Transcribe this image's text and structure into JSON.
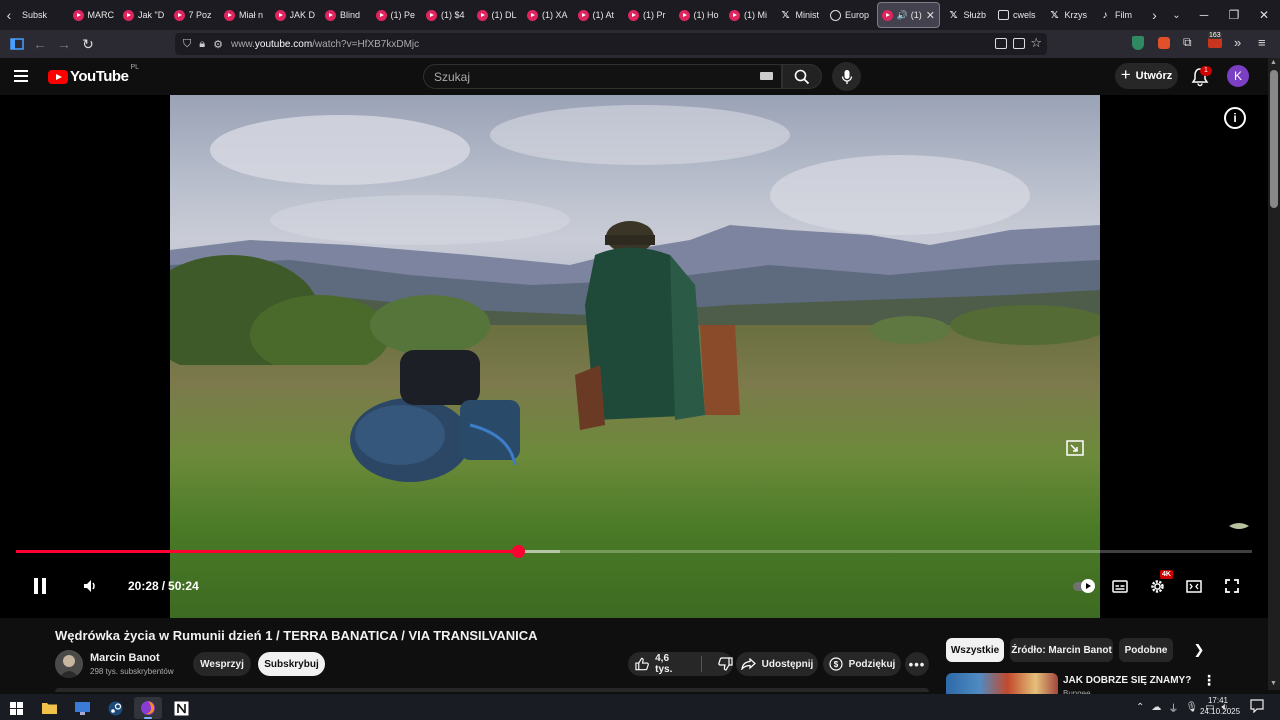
{
  "browser": {
    "tabs": [
      {
        "label": "Subsk",
        "icon": "youtube-icon",
        "kind": "none"
      },
      {
        "label": "MARC",
        "icon": "youtube-icon",
        "kind": "yt"
      },
      {
        "label": "Jak \"D",
        "icon": "youtube-icon",
        "kind": "yt"
      },
      {
        "label": "7 Poz",
        "icon": "youtube-icon",
        "kind": "yt"
      },
      {
        "label": "Miał n",
        "icon": "youtube-icon",
        "kind": "yt"
      },
      {
        "label": "JAK D",
        "icon": "youtube-icon",
        "kind": "yt"
      },
      {
        "label": "Blind",
        "icon": "youtube-icon",
        "kind": "yt"
      },
      {
        "label": "(1) Pe",
        "icon": "youtube-icon",
        "kind": "yt"
      },
      {
        "label": "(1) $4",
        "icon": "youtube-icon",
        "kind": "yt"
      },
      {
        "label": "(1) DL",
        "icon": "youtube-icon",
        "kind": "yt"
      },
      {
        "label": "(1) XA",
        "icon": "youtube-icon",
        "kind": "yt"
      },
      {
        "label": "(1) At",
        "icon": "youtube-icon",
        "kind": "yt"
      },
      {
        "label": "(1) Pr",
        "icon": "youtube-icon",
        "kind": "yt"
      },
      {
        "label": "(1) Ho",
        "icon": "youtube-icon",
        "kind": "yt"
      },
      {
        "label": "(1) Mi",
        "icon": "youtube-icon",
        "kind": "yt"
      },
      {
        "label": "Minist",
        "icon": "x-icon",
        "kind": "x"
      },
      {
        "label": "Europ",
        "icon": "globe-icon",
        "kind": "globe"
      }
    ],
    "active_tab": {
      "label": "(1)"
    },
    "tabs_after": [
      {
        "label": "Służb",
        "icon": "x-icon",
        "kind": "x"
      },
      {
        "label": "cwels",
        "icon": "doc-icon",
        "kind": "doc"
      },
      {
        "label": "Krzys",
        "icon": "x-icon",
        "kind": "x"
      },
      {
        "label": "Film",
        "icon": "tiktok-icon",
        "kind": "tt"
      }
    ],
    "url_prefix": "www.",
    "url_host": "youtube.com",
    "url_path": "/watch?v=HfXB7kxDMjc",
    "extension_badge": "163"
  },
  "youtube": {
    "logo_text": "YouTube",
    "logo_country": "PL",
    "search_placeholder": "Szukaj",
    "create_label": "Utwórz",
    "notifications_count": "1",
    "avatar_letter": "K"
  },
  "player": {
    "current_time": "20:28",
    "time_separator": "/",
    "duration": "50:24",
    "progress_fraction": 0.406,
    "buffered_fraction": 0.44,
    "quality_badge": "4K"
  },
  "video": {
    "title": "Wędrówka życia w Rumunii dzień 1 / TERRA BANATICA / VIA TRANSILVANICA",
    "channel_name": "Marcin Banot",
    "subscribers": "298 tys. subskrybentów",
    "join_label": "Wesprzyj",
    "subscribe_label": "Subskrybuj",
    "likes": "4,6 tys.",
    "share_label": "Udostępnij",
    "thanks_label": "Podziękuj"
  },
  "sidebar": {
    "chips": [
      "Wszystkie",
      "Źródło: Marcin Banot",
      "Podobne"
    ],
    "recommendation": {
      "title": "JAK DOBRZE SIĘ ZNAMY?",
      "channel": "Bungee"
    }
  },
  "taskbar": {
    "time": "17:41",
    "date": "24.10.2025"
  },
  "colors": {
    "accent_red": "#ff0033",
    "background": "#0f0f0f",
    "avatar_purple": "#7b3fc4"
  }
}
